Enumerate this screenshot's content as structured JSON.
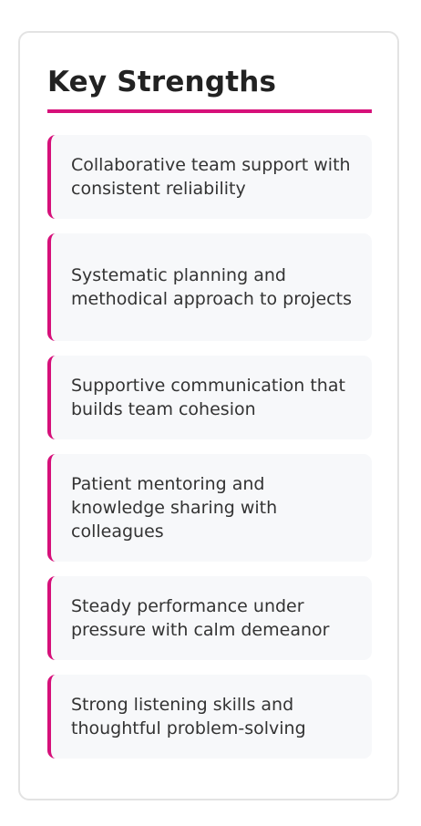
{
  "panel": {
    "title": "Key Strengths",
    "accent_color": "#d6107a"
  },
  "strengths": [
    {
      "text": "Collaborative team support with consistent reliability"
    },
    {
      "text": "Systematic planning and methodical approach to projects"
    },
    {
      "text": "Supportive communication that builds team cohesion"
    },
    {
      "text": "Patient mentoring and knowledge sharing with colleagues"
    },
    {
      "text": "Steady performance under pressure with calm demeanor"
    },
    {
      "text": "Strong listening skills and thoughtful problem-solving"
    }
  ]
}
